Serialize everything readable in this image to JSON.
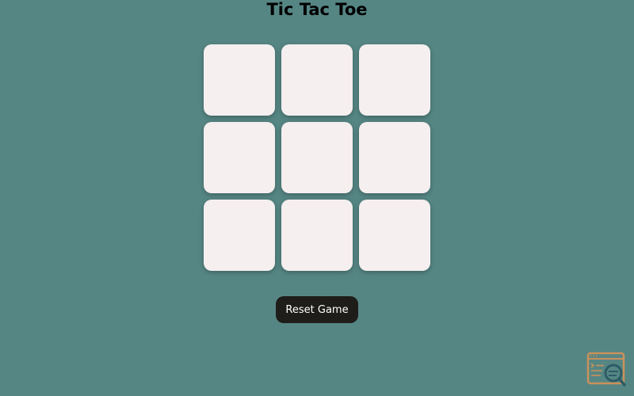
{
  "page": {
    "title": "Tic Tac Toe"
  },
  "board": {
    "cells": [
      "",
      "",
      "",
      "",
      "",
      "",
      "",
      "",
      ""
    ]
  },
  "controls": {
    "reset_label": "Reset Game"
  },
  "icons": {
    "corner": "code-search-icon"
  },
  "colors": {
    "background": "#558684",
    "cell": "#f5efef",
    "button": "#1f1d1a",
    "button_text": "#ffffff",
    "icon_orange": "#c9915a",
    "icon_teal": "#2c5c66"
  }
}
